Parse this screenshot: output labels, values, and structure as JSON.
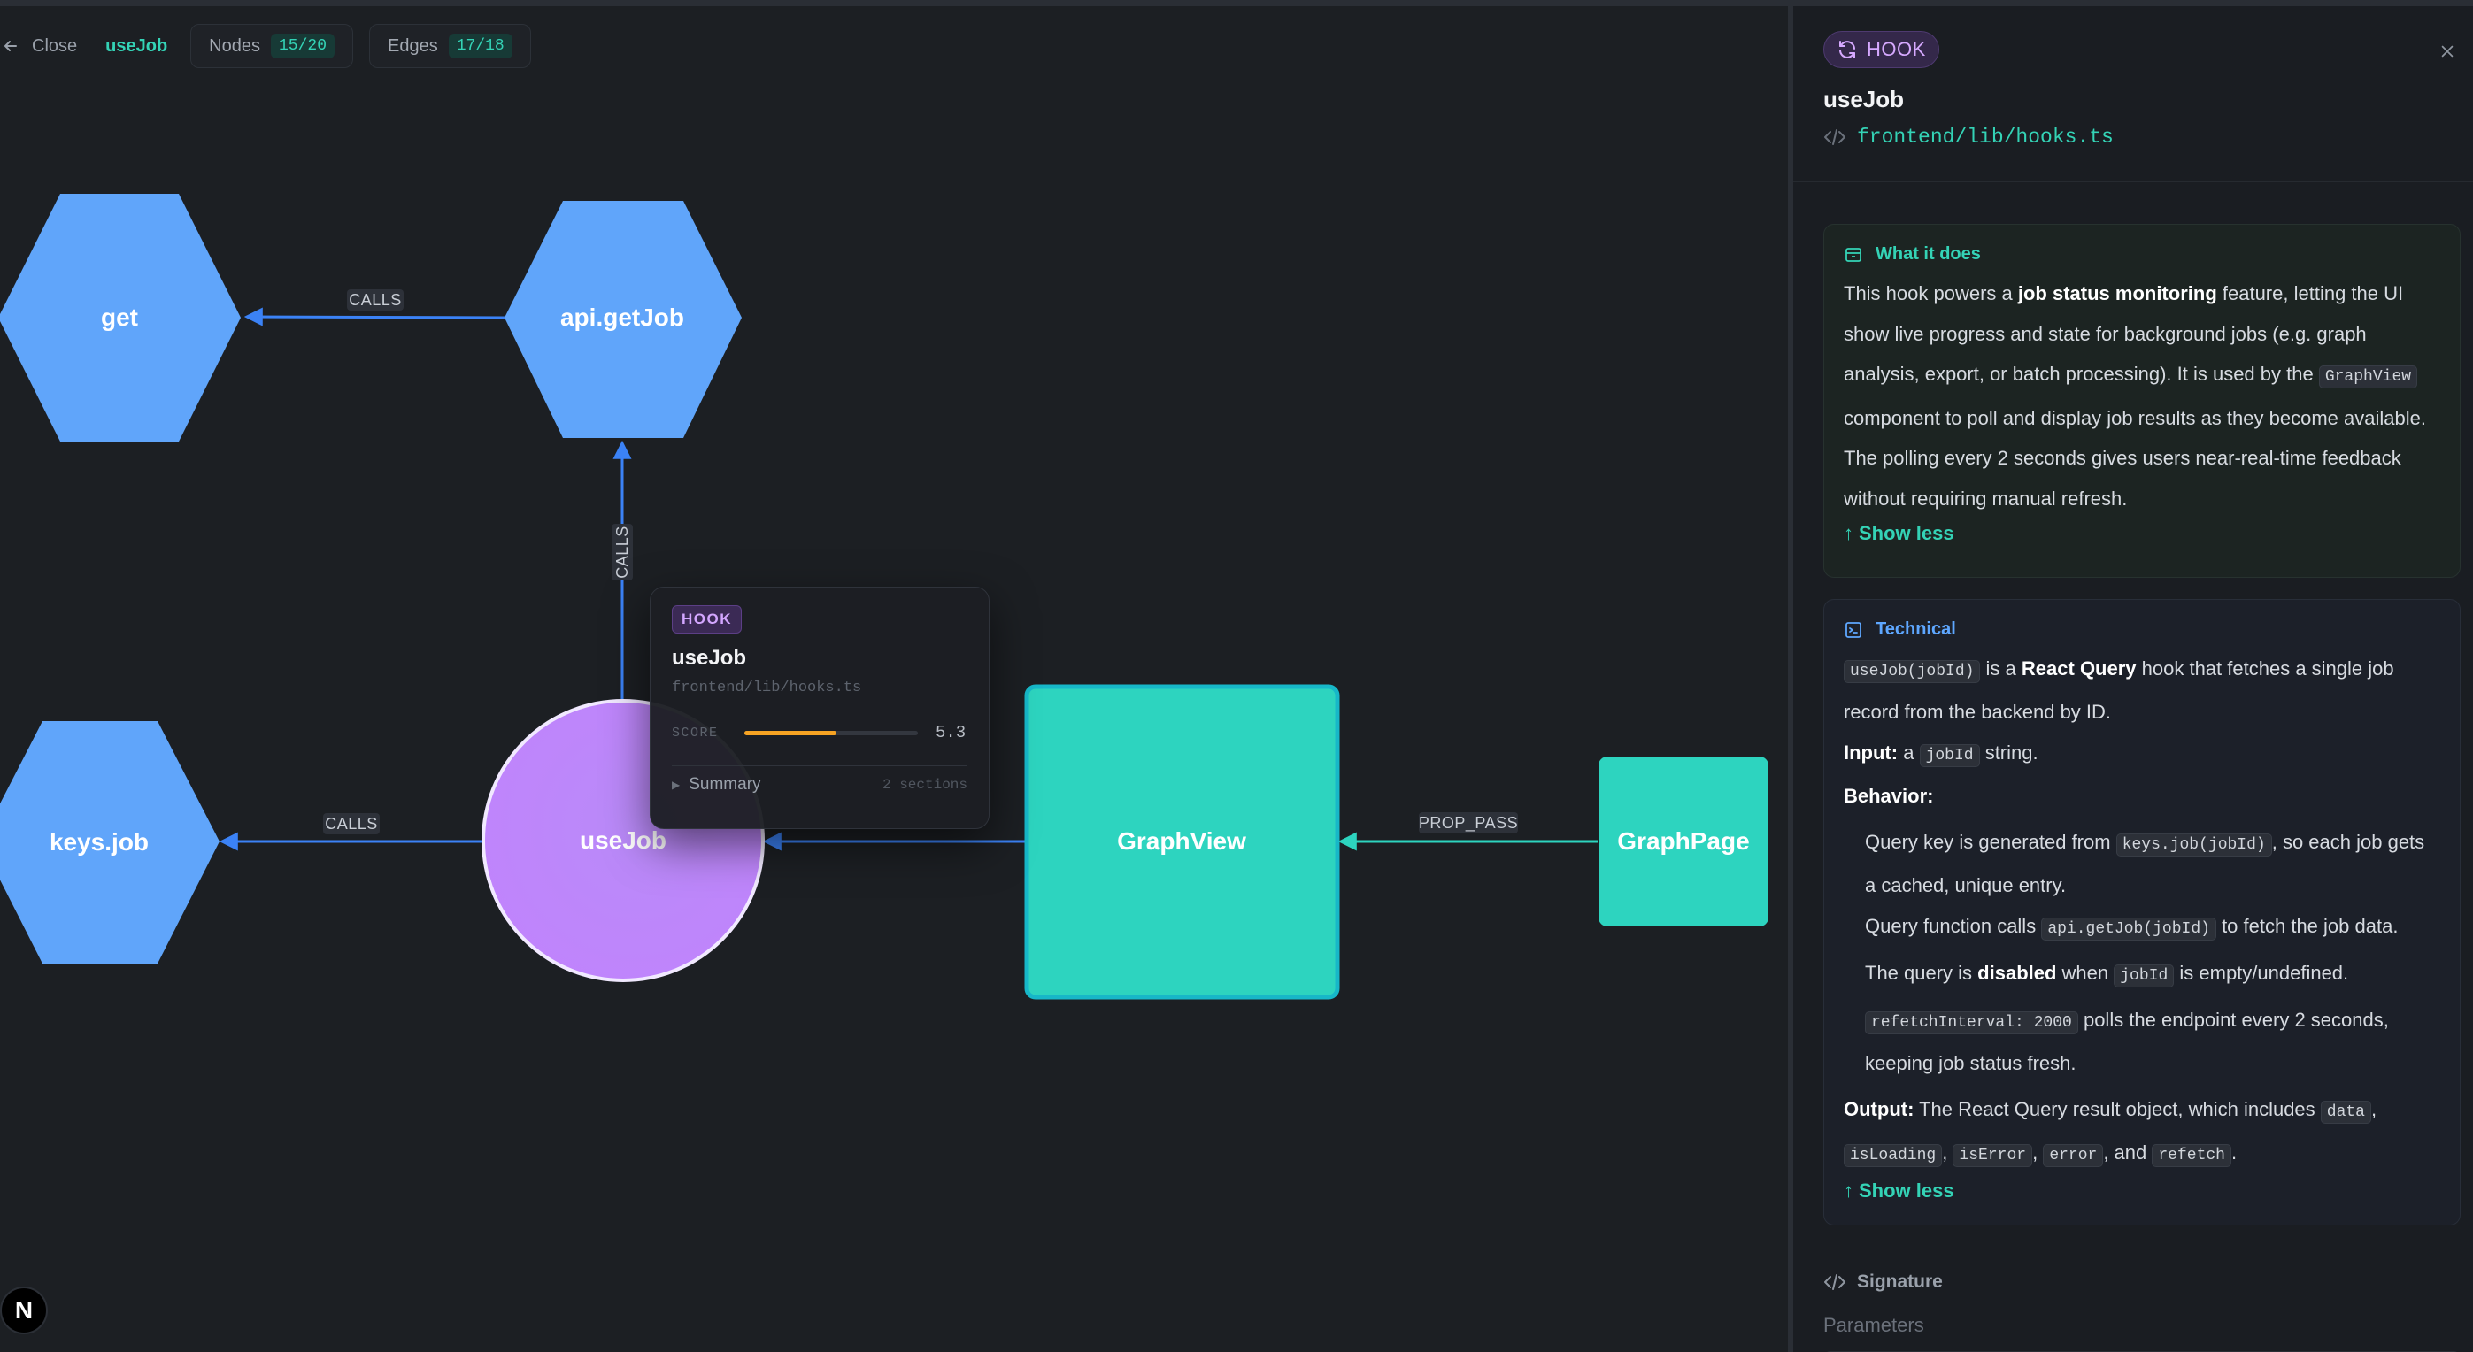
{
  "toolbar": {
    "close_label": "Close",
    "current_node": "useJob",
    "nodes_label": "Nodes",
    "nodes_count": "15/20",
    "edges_label": "Edges",
    "edges_count": "17/18"
  },
  "graph": {
    "nodes": {
      "get": "get",
      "api_getjob": "api.getJob",
      "keys_job": "keys.job",
      "usejob": "useJob",
      "graphview": "GraphView",
      "graphpage": "GraphPage"
    },
    "edges": {
      "api_to_get": "CALLS",
      "usejob_to_api": "CALLS",
      "usejob_to_keys": "CALLS",
      "graphpage_to_graphview": "PROP_PASS"
    },
    "colors": {
      "function_node": "#60a5fa",
      "hook_node": "#c084fc",
      "component_node": "#2dd4bf",
      "calls_edge": "#3b82f6",
      "prop_edge": "#2dd4bf"
    }
  },
  "hover_card": {
    "badge": "HOOK",
    "title": "useJob",
    "path": "frontend/lib/hooks.ts",
    "score_label": "SCORE",
    "score_value": "5.3",
    "score_fraction": 0.53,
    "summary_label": "Summary",
    "sections_label": "2 sections"
  },
  "logo": {
    "letter": "N"
  },
  "panel": {
    "kind_badge": "HOOK",
    "title": "useJob",
    "path": "frontend/lib/hooks.ts",
    "what": {
      "heading": "What it does",
      "p1": "This hook powers a ",
      "b1": "job status monitoring",
      "p2": " feature, letting the UI show live progress and state for background jobs (e.g. graph analysis, export, or batch processing). It is used by the ",
      "code1": "GraphView",
      "p3": " component to poll and display job results as they become available. The polling every 2 seconds gives users near-real-time feedback without requiring manual refresh.",
      "show_less": "Show less"
    },
    "technical": {
      "heading": "Technical",
      "intro_code": "useJob(jobId)",
      "intro_t1": " is a ",
      "intro_b": "React Query",
      "intro_t2": " hook that fetches a single job record from the backend by ID.",
      "input_label": "Input:",
      "input_t1": " a ",
      "input_code": "jobId",
      "input_t2": " string.",
      "behavior_label": "Behavior:",
      "b1_t1": "Query key is generated from ",
      "b1_code": "keys.job(jobId)",
      "b1_t2": ", so each job gets a cached, unique entry.",
      "b2_t1": "Query function calls ",
      "b2_code": "api.getJob(jobId)",
      "b2_t2": " to fetch the job data.",
      "b3_t1": "The query is ",
      "b3_b": "disabled",
      "b3_t2": " when ",
      "b3_code": "jobId",
      "b3_t3": " is empty/undefined.",
      "b4_code": "refetchInterval: 2000",
      "b4_t1": " polls the endpoint every 2 seconds, keeping job status fresh.",
      "output_label": "Output:",
      "output_t1": " The React Query result object, which includes ",
      "output_c1": "data",
      "output_sep1": ", ",
      "output_c2": "isLoading",
      "output_sep2": ", ",
      "output_c3": "isError",
      "output_sep3": ", ",
      "output_c4": "error",
      "output_sep4": ", and ",
      "output_c5": "refetch",
      "output_end": ".",
      "show_less": "Show less"
    },
    "signature_heading": "Signature",
    "parameters_label": "Parameters"
  }
}
